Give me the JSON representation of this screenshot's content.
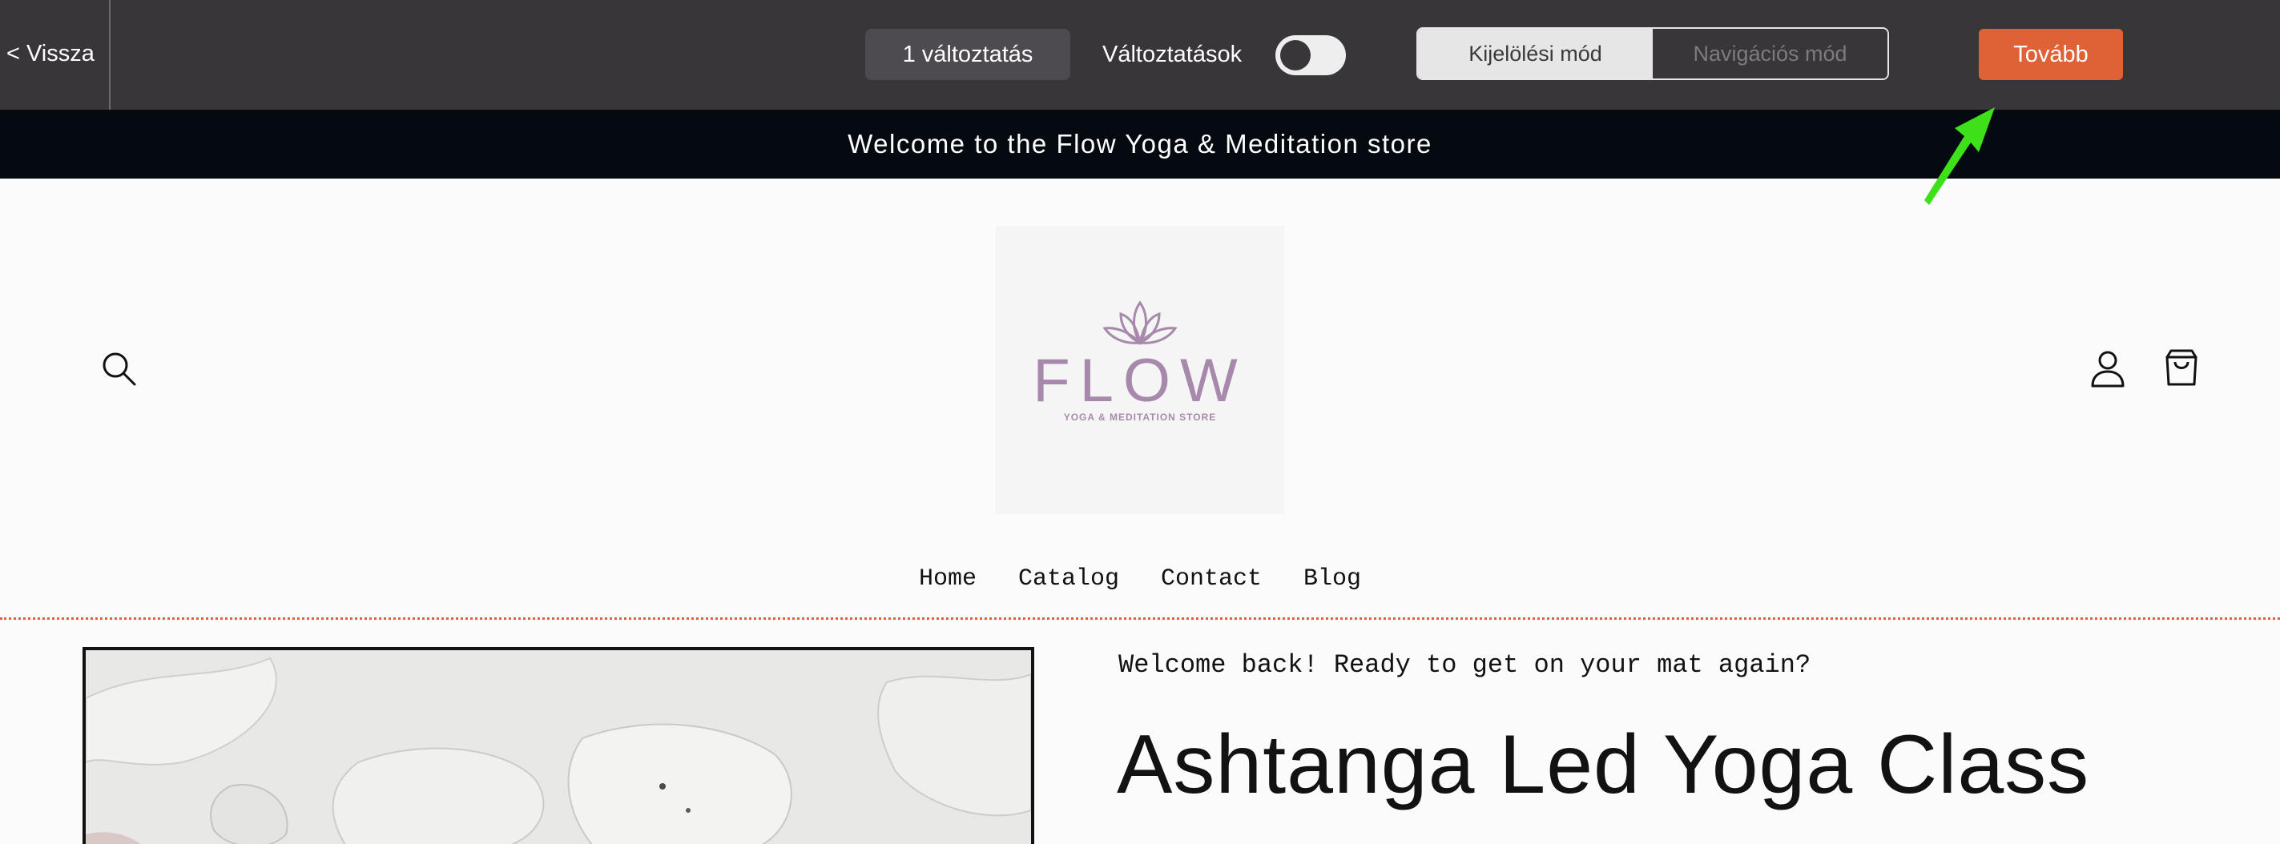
{
  "toolbar": {
    "back_label": "< Vissza",
    "changes_count_label": "1 változtatás",
    "changes_toggle_label": "Változtatások",
    "changes_toggle_on": false,
    "modes": [
      "Kijelölési mód",
      "Navigációs mód"
    ],
    "active_mode": "Kijelölési mód",
    "next_label": "Tovább"
  },
  "announcement": {
    "text": "Welcome to the Flow Yoga & Meditation store"
  },
  "header": {
    "logo_title": "FLOW",
    "logo_tagline": "YOGA & MEDITATION STORE",
    "icons": [
      "search-icon",
      "account-icon",
      "cart-icon"
    ]
  },
  "nav": {
    "items": [
      "Home",
      "Catalog",
      "Contact",
      "Blog"
    ]
  },
  "main": {
    "welcome_text": "Welcome back! Ready to get on your mat again?",
    "product_title": "Ashtanga Led Yoga Class"
  },
  "colors": {
    "toolbar_bg": "#39363a",
    "accent": "#df6236",
    "announcement_bg": "#040a10",
    "logo": "#a78aab",
    "guide_arrow": "#3ee01a"
  }
}
